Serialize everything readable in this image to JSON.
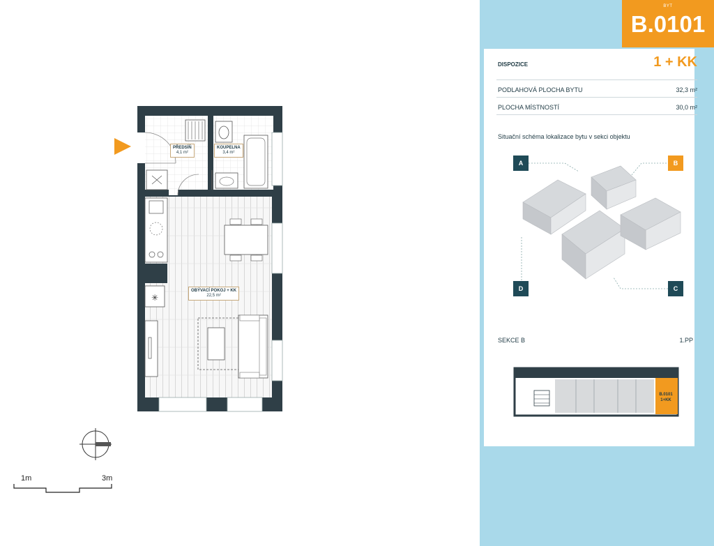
{
  "unit": {
    "kicker": "BYT",
    "code": "B.0101"
  },
  "summary": {
    "disposition_label": "DISPOZICE",
    "disposition_value": "1 + KK",
    "rows": [
      {
        "label": "PODLAHOVÁ PLOCHA BYTU",
        "value": "32,3 m²"
      },
      {
        "label": "PLOCHA MÍSTNOSTÍ",
        "value": "30,0 m²"
      }
    ]
  },
  "situation": {
    "caption": "Situační schéma lokalizace bytu v sekci objektu",
    "corners": [
      "A",
      "B",
      "C",
      "D"
    ],
    "highlight_corner": "B"
  },
  "section": {
    "label": "SEKCE B",
    "floor": "1.PP",
    "unit_line1": "B.0101",
    "unit_line2": "1+KK"
  },
  "rooms": [
    {
      "name": "PŘEDSÍŇ",
      "area": "4,1 m²"
    },
    {
      "name": "KOUPELNA",
      "area": "3,4 m²"
    },
    {
      "name": "OBÝVACÍ POKOJ + KK",
      "area": "22,5 m²"
    }
  ],
  "scale": {
    "left": "1m",
    "right": "3m"
  },
  "colors": {
    "accent": "#f29a1f",
    "panel": "#a9d9ea",
    "wall": "#2f3f47",
    "corner_box": "#1f4a57"
  }
}
